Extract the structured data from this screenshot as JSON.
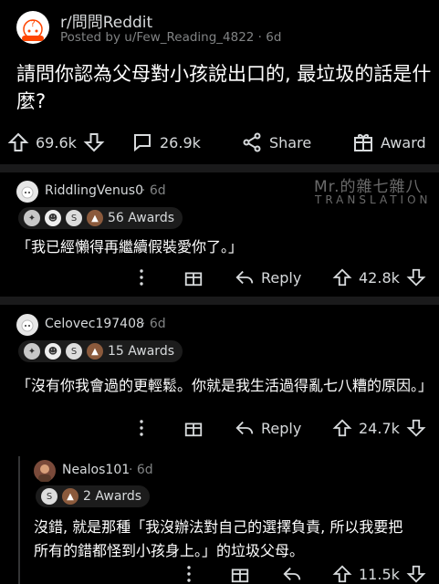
{
  "post": {
    "subreddit": "r/問問Reddit",
    "posted_by": "Posted by u/Few_Reading_4822 · 6d",
    "title": "請問你認為父母對小孩說出口的, 最垃圾的話是什麼?",
    "upvotes": "69.6k",
    "comments": "26.9k",
    "share_label": "Share",
    "award_label": "Award"
  },
  "watermark": {
    "line1": "Mr.的雜七雜八",
    "line2": "TRANSLATION"
  },
  "comments": [
    {
      "user": "RiddlingVenus0",
      "age": "· 6d",
      "awards": "56 Awards",
      "text": "「我已經懶得再繼續假裝愛你了。」",
      "reply_label": "Reply",
      "votes": "42.8k"
    },
    {
      "user": "Celovec197408",
      "age": "· 6d",
      "awards": "15 Awards",
      "text": "「沒有你我會過的更輕鬆。你就是我生活過得亂七八糟的原因。」",
      "reply_label": "Reply",
      "votes": "24.7k"
    },
    {
      "user": "Nealos101",
      "age": "· 6d",
      "awards": "2 Awards",
      "text": "沒錯, 就是那種「我沒辦法對自己的選擇負責, 所以我要把所有的錯都怪到小孩身上。」的垃圾父母。",
      "votes": "11.5k"
    }
  ]
}
